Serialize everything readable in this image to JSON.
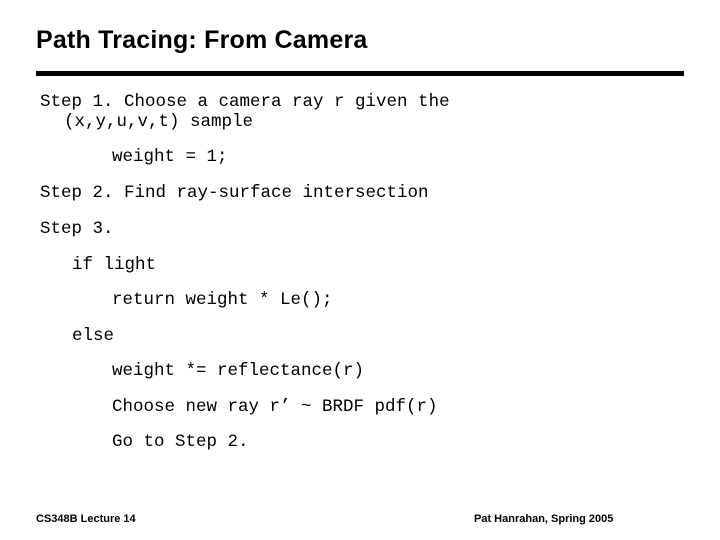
{
  "slide": {
    "title": "Path Tracing: From Camera",
    "accent_color": "#000000",
    "background_color": "#ffffff",
    "body_lines": [
      "Step 1. Choose a camera ray r given the",
      "(x,y,u,v,t) sample",
      "weight = 1;",
      "Step 2. Find ray-surface intersection",
      "Step 3.",
      "if light",
      "return weight * Le();",
      "else",
      "weight *= reflectance(r)",
      "Choose new ray r’ ~ BRDF pdf(r)",
      "Go to Step 2."
    ],
    "footer": {
      "left": "CS348B Lecture 14",
      "right": "Pat Hanrahan, Spring 2005"
    }
  }
}
